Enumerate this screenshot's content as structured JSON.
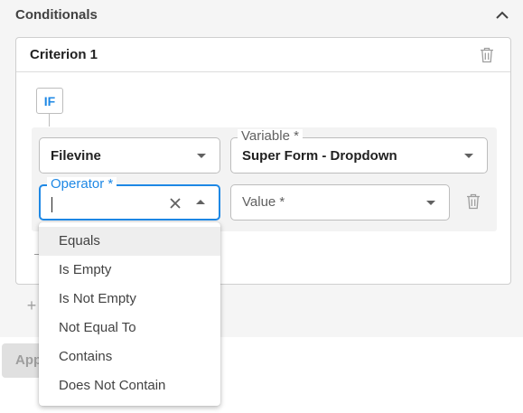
{
  "section": {
    "title": "Conditionals"
  },
  "criterion": {
    "title": "Criterion 1",
    "if_label": "IF"
  },
  "source_field": {
    "value": "Filevine"
  },
  "variable_field": {
    "label": "Variable *",
    "value": "Super Form - Dropdown"
  },
  "operator_field": {
    "label": "Operator *",
    "value": ""
  },
  "value_field": {
    "placeholder": "Value *"
  },
  "operator_options": [
    "Equals",
    "Is Empty",
    "Is Not Empty",
    "Not Equal To",
    "Contains",
    "Does Not Contain"
  ],
  "apply_button": {
    "label": "App"
  },
  "colors": {
    "accent": "#1e88e5",
    "panel_bg": "#f5f5f5",
    "button_bg": "#e0e0e0"
  },
  "icons": [
    "chevron-up-icon",
    "trash-icon",
    "caret-down-icon",
    "caret-up-icon",
    "close-icon",
    "plus-icon"
  ]
}
